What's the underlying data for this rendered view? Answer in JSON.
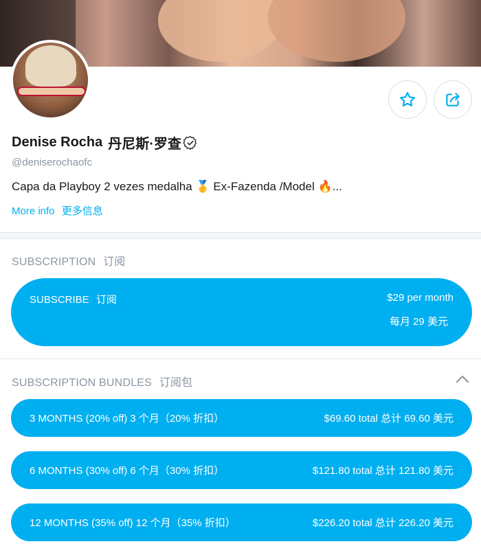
{
  "profile": {
    "name": "Denise Rocha",
    "name_cn": "丹尼斯·罗查",
    "handle": "@deniserochaofc",
    "bio": "Capa da Playboy 2 vezes medalha 🥇 Ex-Fazenda /Model 🔥...",
    "more_info": "More info",
    "more_info_cn": "更多信息"
  },
  "subscription": {
    "title": "SUBSCRIPTION",
    "title_cn": "订阅",
    "button_label": "SUBSCRIBE",
    "button_label_cn": "订阅",
    "price": "$29 per month",
    "price_cn": "每月 29 美元"
  },
  "bundles": {
    "title": "SUBSCRIPTION BUNDLES",
    "title_cn": "订阅包",
    "items": [
      {
        "label": "3 MONTHS (20% off) 3 个月（20% 折扣）",
        "price": "$69.60 total 总计 69.60 美元"
      },
      {
        "label": "6 MONTHS (30% off) 6 个月（30% 折扣）",
        "price": "$121.80 total 总计 121.80 美元"
      },
      {
        "label": "12 MONTHS (35% off) 12 个月（35% 折扣）",
        "price": "$226.20 total 总计 226.20 美元"
      }
    ]
  },
  "icons": {
    "favorite": "star-icon",
    "share": "share-icon",
    "verified": "verified-badge-icon",
    "collapse": "chevron-up-icon"
  },
  "colors": {
    "accent": "#00aff0",
    "muted_text": "#8a96a3"
  }
}
